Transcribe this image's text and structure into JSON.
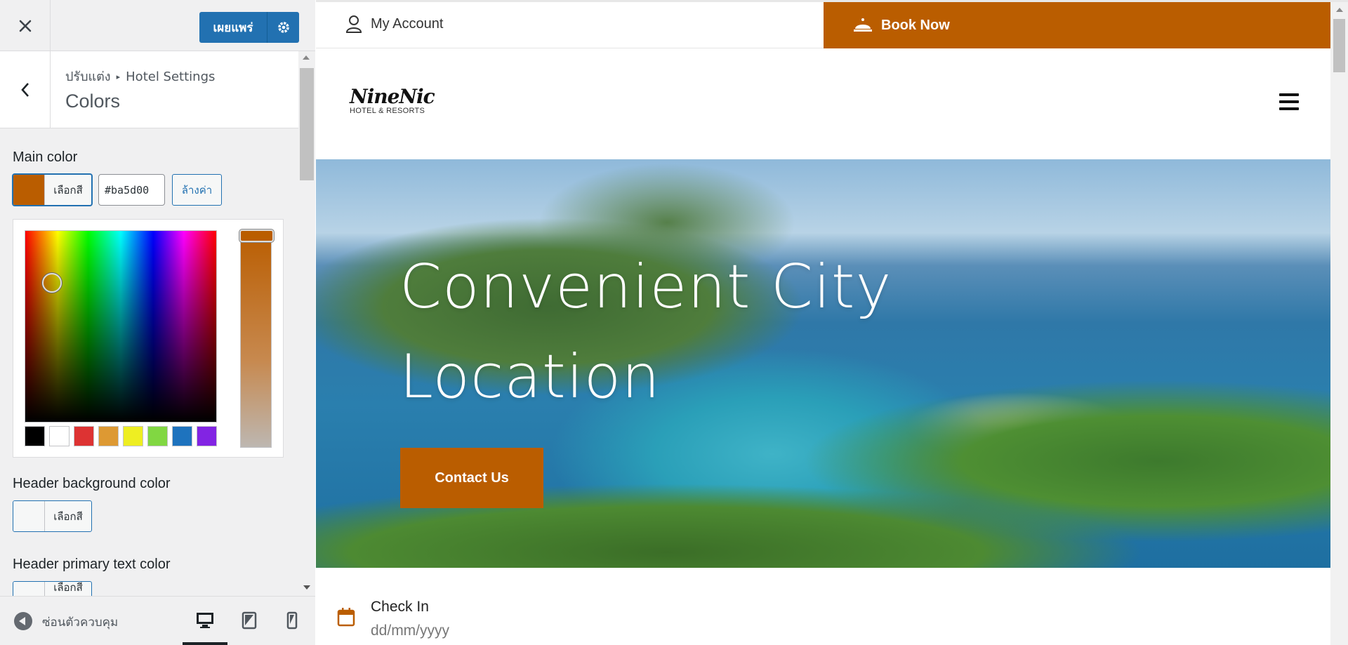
{
  "customizer": {
    "close_icon": "close-icon",
    "publish_label": "เผยแพร่",
    "publish_settings_icon": "gear-icon",
    "breadcrumb_root": "ปรับแต่ง",
    "breadcrumb_parent": "Hotel Settings",
    "section_title": "Colors",
    "main_color": {
      "label": "Main color",
      "button_label": "เลือกสี",
      "value": "#ba5d00",
      "clear_label": "ล้างค่า"
    },
    "palette": [
      "#000000",
      "#ffffff",
      "#dd3333",
      "#dd9933",
      "#eeee22",
      "#81d742",
      "#1e73be",
      "#8224e3"
    ],
    "header_bg": {
      "label": "Header background color",
      "button_label": "เลือกสี"
    },
    "header_primary_text": {
      "label": "Header primary text color",
      "button_label": "เลือกสี"
    },
    "footer": {
      "collapse_label": "ซ่อนตัวควบคุม"
    }
  },
  "preview": {
    "account_label": "My Account",
    "book_now_label": "Book Now",
    "logo_main": "NineNic",
    "logo_sub": "HOTEL & RESORTS",
    "hero_title": "Convenient City Location",
    "contact_label": "Contact Us",
    "checkin_label": "Check In",
    "checkin_placeholder": "dd/mm/yyyy"
  },
  "colors": {
    "accent": "#ba5d00",
    "wp_blue": "#2271b1"
  }
}
